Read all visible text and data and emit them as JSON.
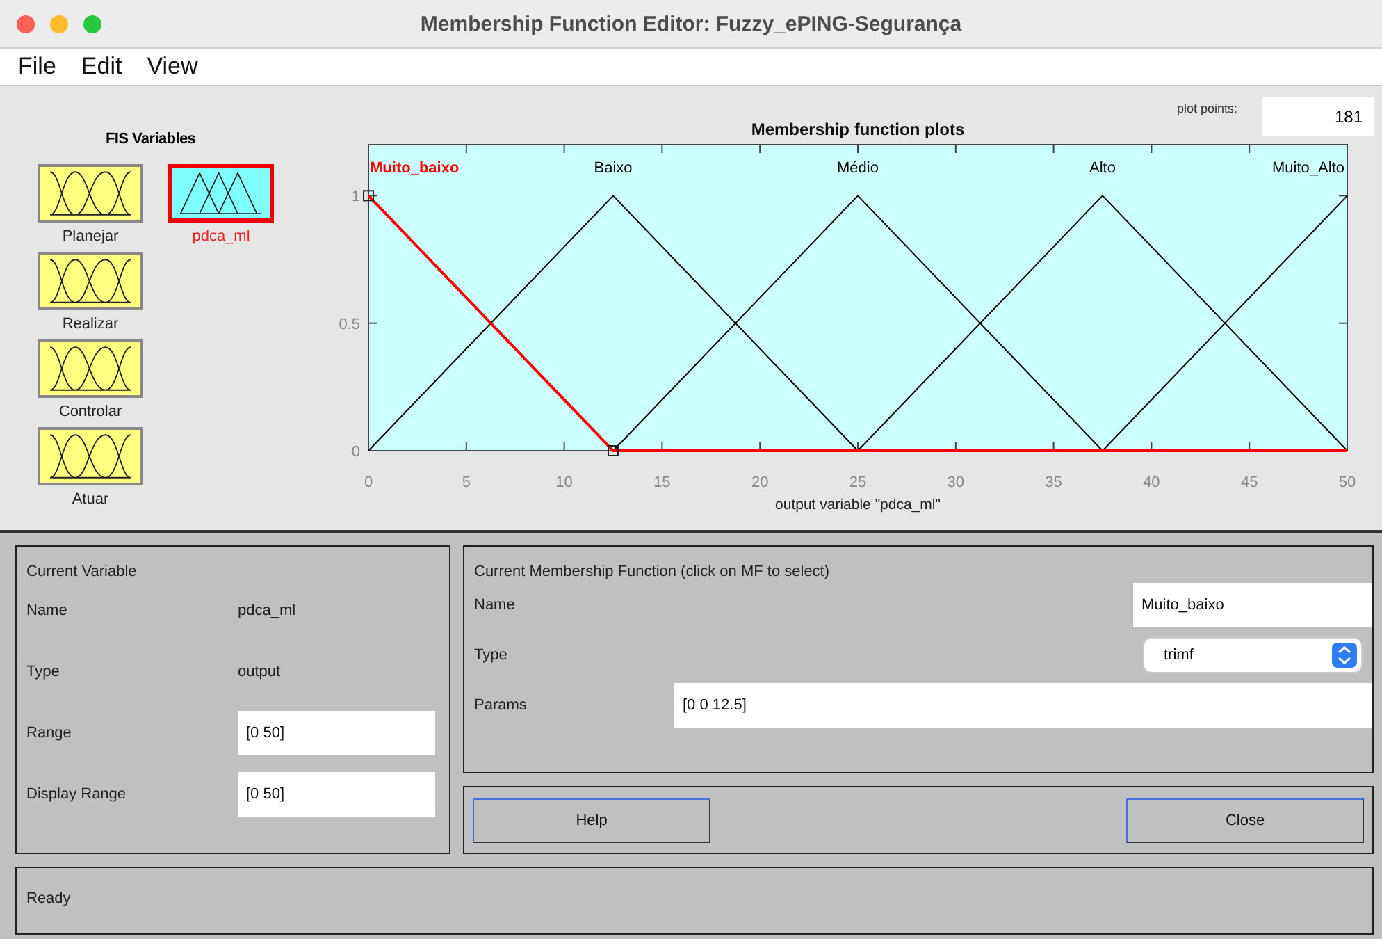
{
  "window": {
    "title": "Membership Function Editor: Fuzzy_ePING-Segurança"
  },
  "menu": [
    "File",
    "Edit",
    "View"
  ],
  "fis_variables": {
    "title": "FIS Variables",
    "items": [
      {
        "name": "Planejar",
        "kind": "input",
        "selected": false
      },
      {
        "name": "Realizar",
        "kind": "input",
        "selected": false
      },
      {
        "name": "Controlar",
        "kind": "input",
        "selected": false
      },
      {
        "name": "Atuar",
        "kind": "input",
        "selected": false
      },
      {
        "name": "pdca_ml",
        "kind": "output",
        "selected": true
      }
    ]
  },
  "plot": {
    "plot_points_label": "plot points:",
    "plot_points": "181",
    "chart_data": {
      "type": "line",
      "title": "Membership function plots",
      "xlabel": "output variable \"pdca_ml\"",
      "x": [
        0,
        12.5,
        25,
        37.5,
        50
      ],
      "series": [
        {
          "name": "Muito_baixo",
          "color": "#ff0000",
          "values": [
            1,
            0,
            0,
            0,
            0
          ]
        },
        {
          "name": "Baixo",
          "color": "#000000",
          "values": [
            0,
            1,
            0,
            null,
            null
          ]
        },
        {
          "name": "Médio",
          "color": "#000000",
          "values": [
            null,
            0,
            1,
            0,
            null
          ]
        },
        {
          "name": "Alto",
          "color": "#000000",
          "values": [
            null,
            null,
            0,
            1,
            0
          ]
        },
        {
          "name": "Muito_Alto",
          "color": "#000000",
          "values": [
            null,
            null,
            null,
            0,
            1
          ]
        }
      ],
      "legend": "top",
      "xlim": [
        0,
        50
      ],
      "ylim": [
        0,
        1.2
      ],
      "xticks": [
        0,
        5,
        10,
        15,
        20,
        25,
        30,
        35,
        40,
        45,
        50
      ],
      "yticks": [
        0,
        0.5,
        1
      ]
    }
  },
  "current_variable": {
    "title": "Current Variable",
    "fields": [
      {
        "label": "Name",
        "value": "pdca_ml",
        "kind": "text"
      },
      {
        "label": "Type",
        "value": "output",
        "kind": "text"
      },
      {
        "label": "Range",
        "value": "[0 50]",
        "kind": "input"
      },
      {
        "label": "Display Range",
        "value": "[0 50]",
        "kind": "input"
      }
    ]
  },
  "current_mf": {
    "title": "Current Membership Function (click on MF to select)",
    "name_label": "Name",
    "name": "Muito_baixo",
    "type_label": "Type",
    "type": "trimf",
    "params_label": "Params",
    "params": "[0 0 12.5]"
  },
  "buttons": [
    "Help",
    "Close"
  ],
  "status": "Ready"
}
